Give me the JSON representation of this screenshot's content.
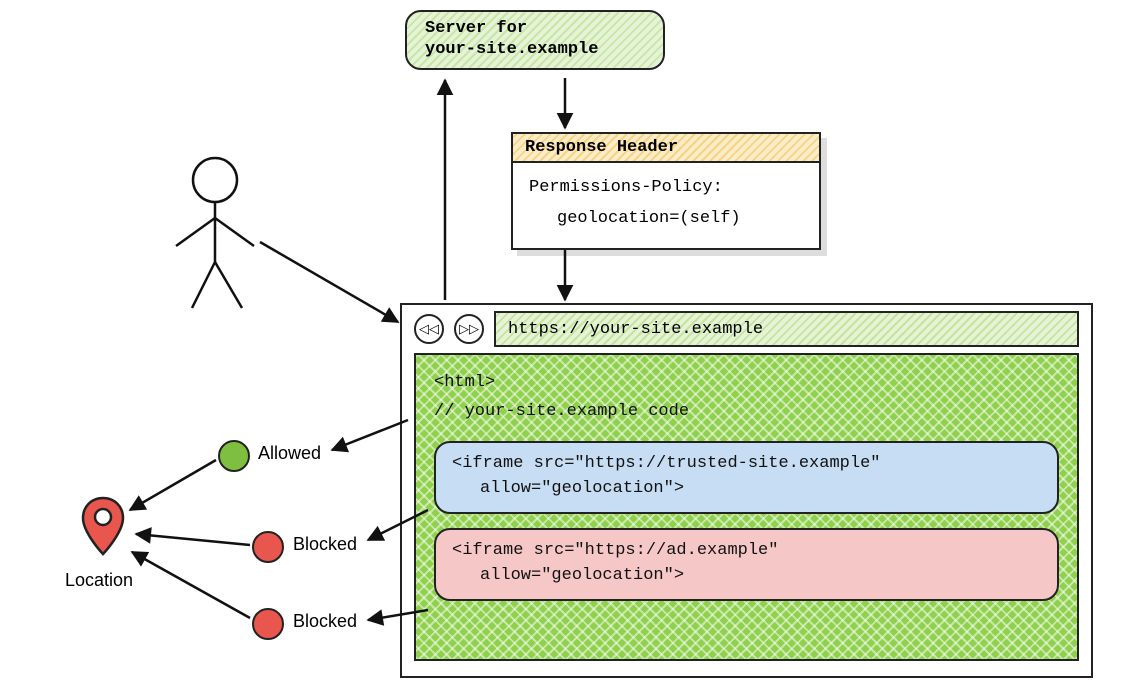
{
  "server": {
    "line1": "Server for",
    "line2": "your-site.example"
  },
  "response_header": {
    "title": "Response Header",
    "line1": "Permissions-Policy:",
    "line2": "geolocation=(self)"
  },
  "browser": {
    "back_glyph": "◁◁",
    "fwd_glyph": "▷▷",
    "address": "https://your-site.example",
    "html_open": "<html>",
    "comment": "// your-site.example code",
    "iframe_trusted_l1": "<iframe src=\"https://trusted-site.example\"",
    "iframe_trusted_l2": "allow=\"geolocation\">",
    "iframe_ad_l1": "<iframe src=\"https://ad.example\"",
    "iframe_ad_l2": "allow=\"geolocation\">"
  },
  "statuses": {
    "allowed": "Allowed",
    "blocked1": "Blocked",
    "blocked2": "Blocked"
  },
  "location_label": "Location"
}
